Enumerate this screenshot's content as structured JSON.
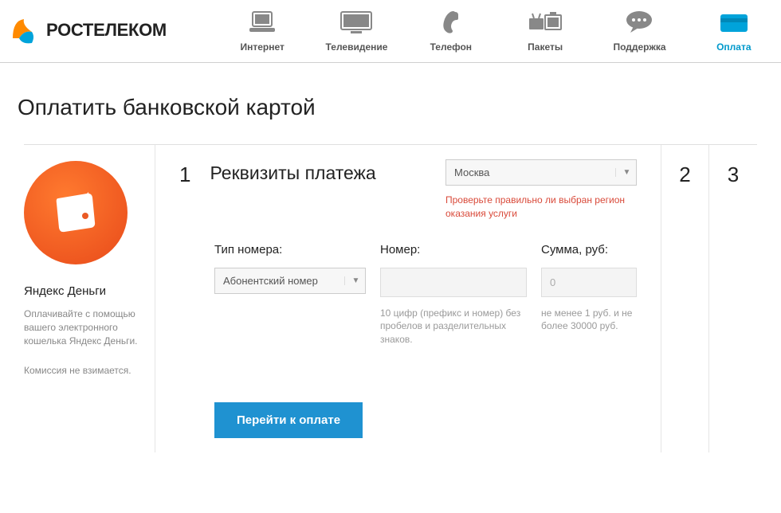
{
  "brand": "РОСТЕЛЕКОМ",
  "nav": {
    "internet": "Интернет",
    "tv": "Телевидение",
    "phone": "Телефон",
    "packages": "Пакеты",
    "support": "Поддержка",
    "payment": "Оплата"
  },
  "page": {
    "title": "Оплатить банковской картой"
  },
  "sidebar": {
    "title": "Яндекс Деньги",
    "desc": "Оплачивайте с помощью вашего электронного кошелька Яндекс Деньги.",
    "note": "Комиссия не взимается."
  },
  "step1": {
    "number": "1",
    "title": "Реквизиты платежа",
    "region": {
      "value": "Москва",
      "warning": "Проверьте правильно ли выбран регион оказания услуги"
    },
    "fields": {
      "type_label": "Тип номера:",
      "type_value": "Абонентский номер",
      "number_label": "Номер:",
      "number_hint": "10 цифр (префикс и номер) без пробелов и разделительных знаков.",
      "sum_label": "Сумма, руб:",
      "sum_placeholder": "0",
      "sum_hint": "не менее 1 руб. и не более 30000 руб."
    },
    "submit": "Перейти к оплате"
  },
  "step2": "2",
  "step3": "3"
}
